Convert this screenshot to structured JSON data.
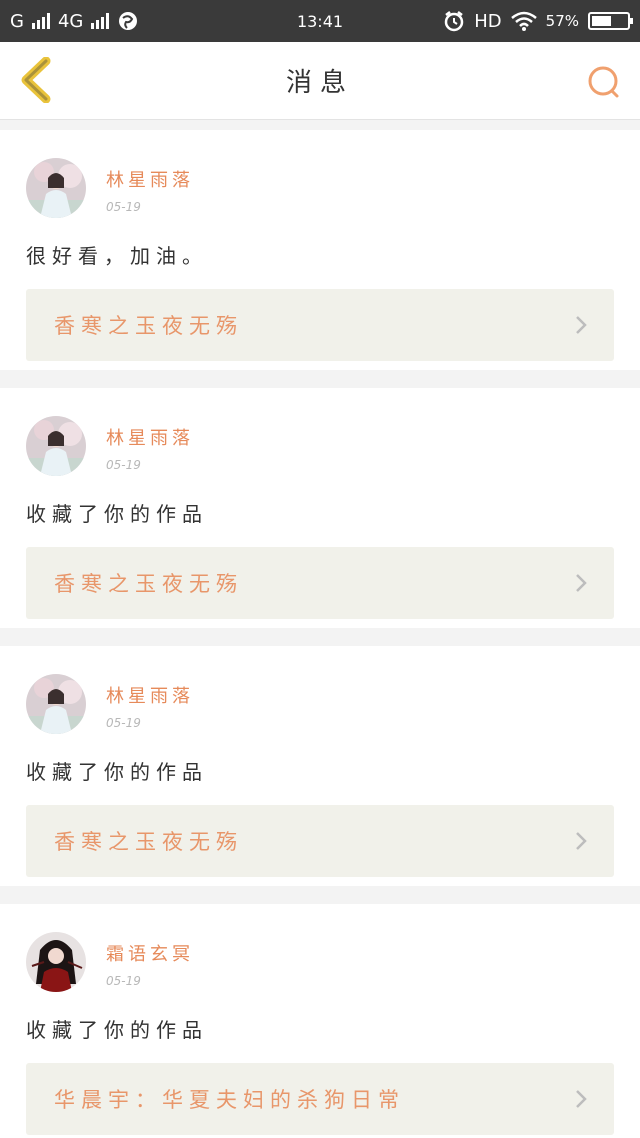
{
  "status_bar": {
    "carrier_left": "G",
    "network": "4G",
    "time": "13:41",
    "hd": "HD",
    "battery": "57%",
    "battery_level": 0.57,
    "icons": [
      "signal-icon",
      "signal-icon",
      "browser-icon",
      "alarm-icon",
      "wifi-icon",
      "battery-icon"
    ]
  },
  "nav": {
    "title": "消息",
    "back_icon": "chevron-left-icon",
    "search_icon": "search-icon"
  },
  "colors": {
    "accent": "#e68a5a",
    "back_icon": "#e9c33b",
    "card_link_bg": "#f1f1ea"
  },
  "messages": [
    {
      "user": "林星雨落",
      "date": "05-19",
      "text": "很好看，加油。",
      "work": "香寒之玉夜无殇",
      "avatar": "girl-white-dress"
    },
    {
      "user": "林星雨落",
      "date": "05-19",
      "text": "收藏了你的作品",
      "work": "香寒之玉夜无殇",
      "avatar": "girl-white-dress"
    },
    {
      "user": "林星雨落",
      "date": "05-19",
      "text": "收藏了你的作品",
      "work": "香寒之玉夜无殇",
      "avatar": "girl-white-dress"
    },
    {
      "user": "霜语玄冥",
      "date": "05-19",
      "text": "收藏了你的作品",
      "work": "华晨宇：华夏夫妇的杀狗日常",
      "avatar": "girl-dark-red"
    }
  ]
}
